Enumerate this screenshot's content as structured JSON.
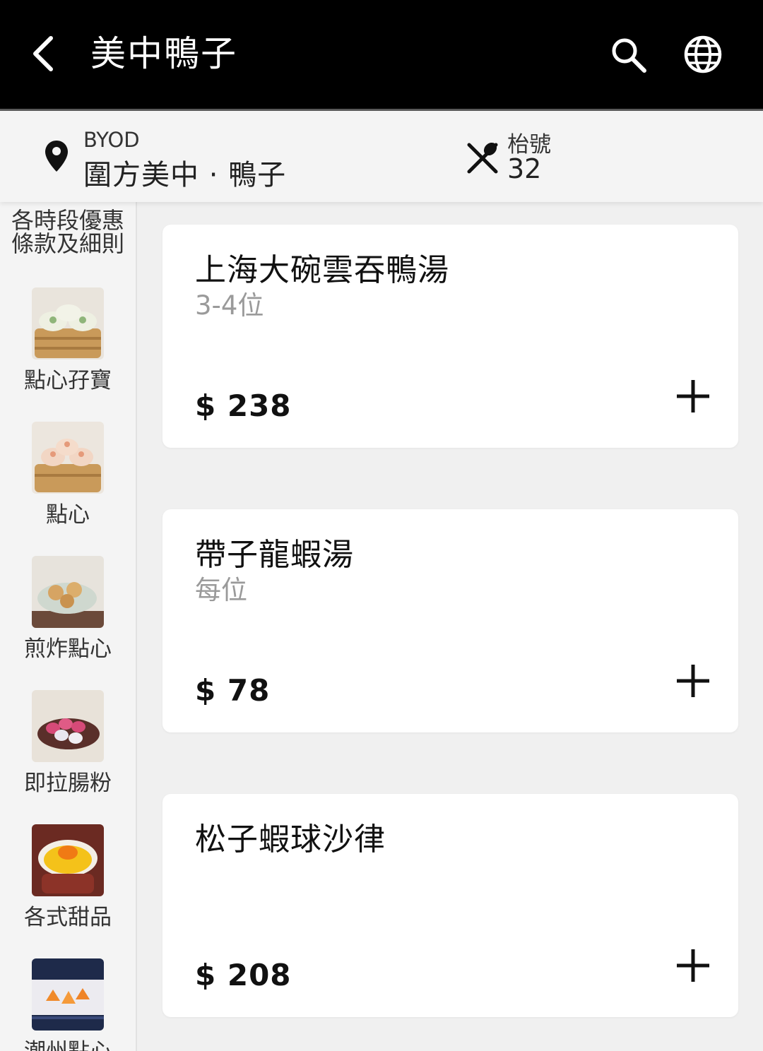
{
  "appbar": {
    "title": "美中鴨子",
    "icons": [
      "back-arrow-icon",
      "search-icon",
      "globe-icon"
    ]
  },
  "info": {
    "mode": "BYOD",
    "store_name": "圍方美中 · 鴨子",
    "table_label": "枱號",
    "table_number": "32"
  },
  "sidebar": {
    "promo_text_line1": "各時段優惠",
    "promo_text_line2": "條款及細則",
    "items": [
      {
        "label": "點心孖寶"
      },
      {
        "label": "點心"
      },
      {
        "label": "煎炸點心"
      },
      {
        "label": "即拉腸粉"
      },
      {
        "label": "各式甜品"
      },
      {
        "label": "潮州點心"
      }
    ]
  },
  "products": [
    {
      "name": "上海大碗雲吞鴨湯",
      "subtitle": "3-4位",
      "price": "$ 238"
    },
    {
      "name": "帶子龍蝦湯",
      "subtitle": "每位",
      "price": "$ 78"
    },
    {
      "name": "松子蝦球沙律",
      "subtitle": "",
      "price": "$ 208"
    }
  ],
  "colors": {
    "appbar_bg": "#000000",
    "page_bg": "#f0f0f0",
    "card_bg": "#ffffff",
    "subtitle_gray": "#9a9a9a"
  }
}
